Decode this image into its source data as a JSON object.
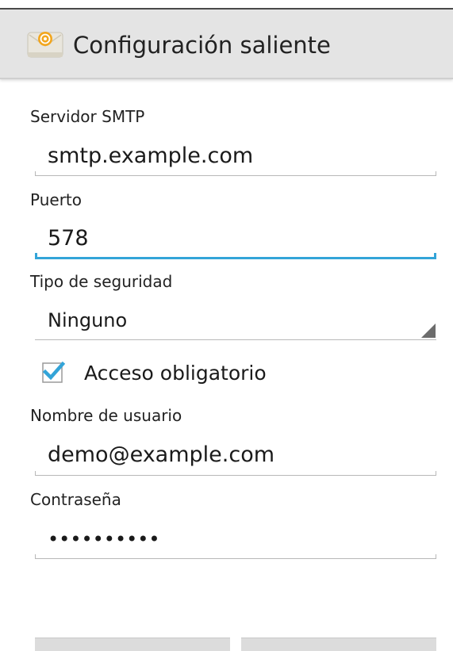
{
  "action_bar": {
    "title": "Configuración saliente",
    "icon": "email-app-icon"
  },
  "fields": {
    "smtp_server": {
      "label": "Servidor SMTP",
      "value": "smtp.example.com"
    },
    "port": {
      "label": "Puerto",
      "value": "578"
    },
    "security_type": {
      "label": "Tipo de seguridad",
      "value": "Ninguno"
    },
    "require_signin": {
      "label": "Acceso obligatorio",
      "checked": true
    },
    "username": {
      "label": "Nombre de usuario",
      "value": "demo@example.com"
    },
    "password": {
      "label": "Contraseña",
      "value": "••••••••••"
    }
  },
  "buttons": {
    "left_label": "",
    "right_label": ""
  },
  "colors": {
    "accent": "#33a4d8",
    "action_bar": "#e4e4e4",
    "checkbox_check": "#33a4d8"
  }
}
